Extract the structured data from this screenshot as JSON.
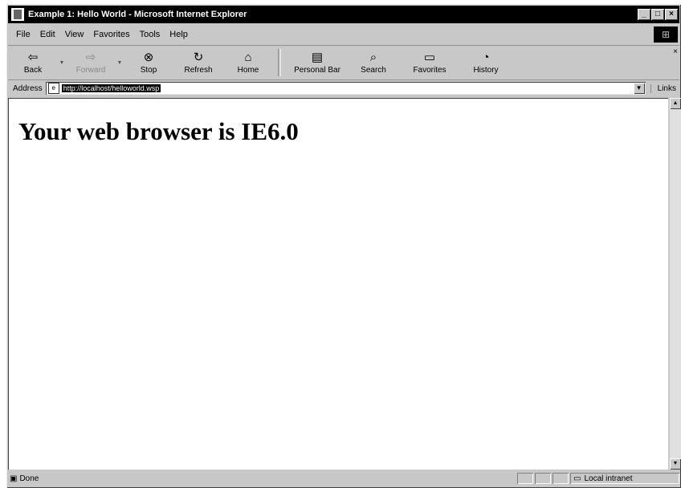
{
  "window": {
    "title": "Example 1: Hello World - Microsoft Internet Explorer",
    "controls": [
      "_",
      "□",
      "×"
    ]
  },
  "menu": [
    "File",
    "Edit",
    "View",
    "Favorites",
    "Tools",
    "Help"
  ],
  "toolbar": {
    "back": {
      "label": "Back",
      "icon": "back-arrow-icon"
    },
    "forward": {
      "label": "Forward",
      "icon": "forward-arrow-icon"
    },
    "stop": {
      "label": "Stop",
      "icon": "stop-icon"
    },
    "refresh": {
      "label": "Refresh",
      "icon": "refresh-icon"
    },
    "home": {
      "label": "Home",
      "icon": "home-icon"
    },
    "personal_bar": {
      "label": "Personal Bar",
      "icon": "personal-bar-icon"
    },
    "search": {
      "label": "Search",
      "icon": "search-icon"
    },
    "favorites": {
      "label": "Favorites",
      "icon": "favorites-icon"
    },
    "history": {
      "label": "History",
      "icon": "history-icon"
    }
  },
  "address": {
    "label": "Address",
    "value": "http://localhost/helloworld.wsp",
    "links_label": "Links"
  },
  "content": {
    "heading": "Your web browser is IE6.0"
  },
  "status": {
    "text": "Done",
    "zone": "Local intranet"
  }
}
